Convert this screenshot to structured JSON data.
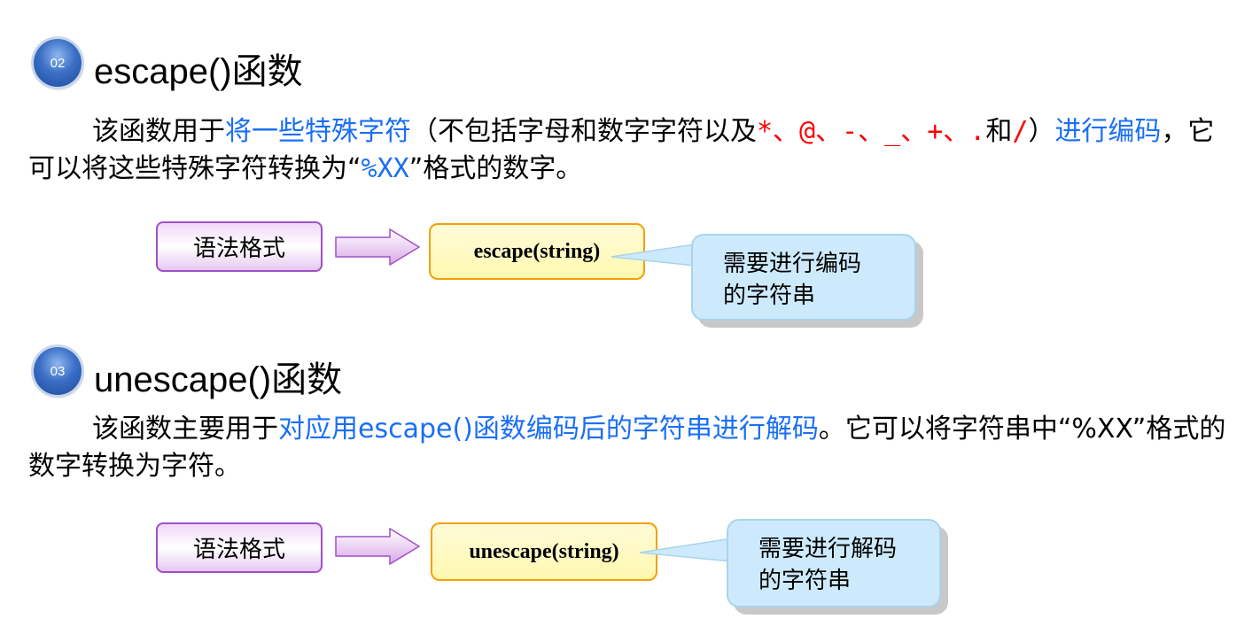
{
  "sections": [
    {
      "badge": "02",
      "title": "escape()函数",
      "para": {
        "p1": "该函数用于",
        "p2": "将一些特殊字符",
        "p3": "（不包括字母和数字字符以及",
        "p4": "*、@、-、_、+、.",
        "p5": "和",
        "p6": "/",
        "p7": "）",
        "p8": "进行编码",
        "p9": "，它可以将这些特殊字符转换为“",
        "p10": "%XX",
        "p11": "”格式的数字。"
      },
      "syntax_label": "语法格式",
      "syntax": "escape(string)",
      "callout": [
        "需要进行编码",
        "的字符串"
      ]
    },
    {
      "badge": "03",
      "title": "unescape()函数",
      "para": {
        "p1": "该函数主要用于",
        "p2": "对应用escape()函数编码后的字符串进行解码",
        "p3": "。它可以将字符串中“%XX”格式的数字转换为字符。"
      },
      "syntax_label": "语法格式",
      "syntax": "unescape(string)",
      "callout": [
        "需要进行解码",
        "的字符串"
      ]
    }
  ]
}
